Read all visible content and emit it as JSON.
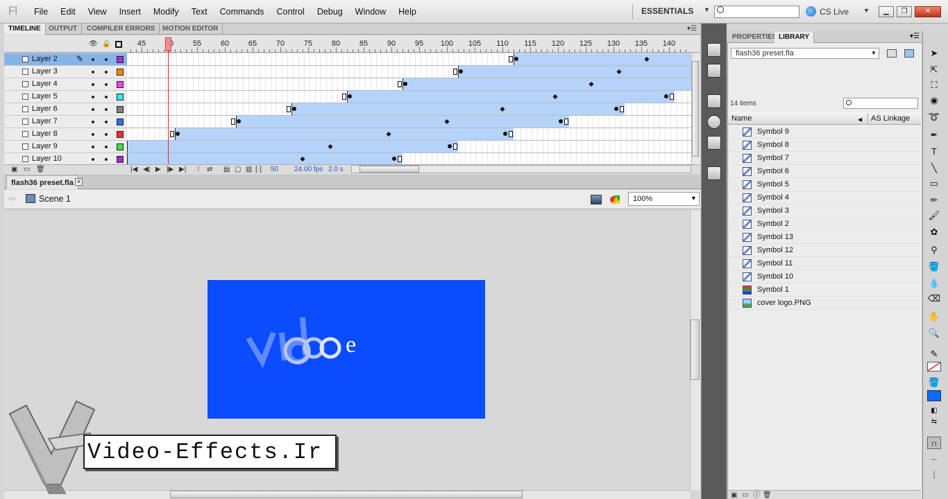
{
  "app": {
    "logo": "Fl"
  },
  "menu": [
    "File",
    "Edit",
    "View",
    "Insert",
    "Modify",
    "Text",
    "Commands",
    "Control",
    "Debug",
    "Window",
    "Help"
  ],
  "workspace": {
    "label": "ESSENTIALS"
  },
  "cslive": {
    "label": "CS Live"
  },
  "timeline": {
    "tabs": [
      "TIMELINE",
      "OUTPUT",
      "COMPILER ERRORS",
      "MOTION EDITOR"
    ],
    "ruler": [
      45,
      50,
      55,
      60,
      65,
      70,
      75,
      80,
      85,
      90,
      95,
      100,
      105,
      110,
      115,
      120,
      125,
      130,
      135,
      140
    ],
    "current_frame": "50",
    "fps": "24.00 fps",
    "time": "2.0 s",
    "layers": [
      {
        "name": "Layer 2",
        "color": "#a030d0",
        "selected": true
      },
      {
        "name": "Layer 3",
        "color": "#ff8c00"
      },
      {
        "name": "Layer 4",
        "color": "#ff40ff"
      },
      {
        "name": "Layer 5",
        "color": "#30f0f0"
      },
      {
        "name": "Layer 6",
        "color": "#808080"
      },
      {
        "name": "Layer 7",
        "color": "#3070f0"
      },
      {
        "name": "Layer 8",
        "color": "#f03030"
      },
      {
        "name": "Layer 9",
        "color": "#40e040"
      },
      {
        "name": "Layer 10",
        "color": "#a030d0"
      }
    ]
  },
  "document": {
    "tab": "flash36 preset.fla",
    "scene": "Scene 1",
    "zoom": "100%",
    "stage_color": "#0a4cff",
    "stage_text": "e",
    "watermark": "Video-Effects.Ir"
  },
  "library": {
    "tabs": [
      "PROPERTIES",
      "LIBRARY"
    ],
    "document": "flash36 preset.fla",
    "count": "14 items",
    "col_name": "Name",
    "col_linkage": "AS Linkage",
    "items": [
      {
        "name": "Symbol 9",
        "type": "movieclip"
      },
      {
        "name": "Symbol 8",
        "type": "movieclip"
      },
      {
        "name": "Symbol 7",
        "type": "movieclip"
      },
      {
        "name": "Symbol 6",
        "type": "movieclip"
      },
      {
        "name": "Symbol 5",
        "type": "movieclip"
      },
      {
        "name": "Symbol 4",
        "type": "movieclip"
      },
      {
        "name": "Symbol 3",
        "type": "movieclip"
      },
      {
        "name": "Symbol 2",
        "type": "movieclip"
      },
      {
        "name": "Symbol 13",
        "type": "movieclip"
      },
      {
        "name": "Symbol 12",
        "type": "movieclip"
      },
      {
        "name": "Symbol 11",
        "type": "movieclip"
      },
      {
        "name": "Symbol 10",
        "type": "movieclip"
      },
      {
        "name": "Symbol 1",
        "type": "graphic"
      },
      {
        "name": "cover logo.PNG",
        "type": "bitmap"
      }
    ]
  }
}
